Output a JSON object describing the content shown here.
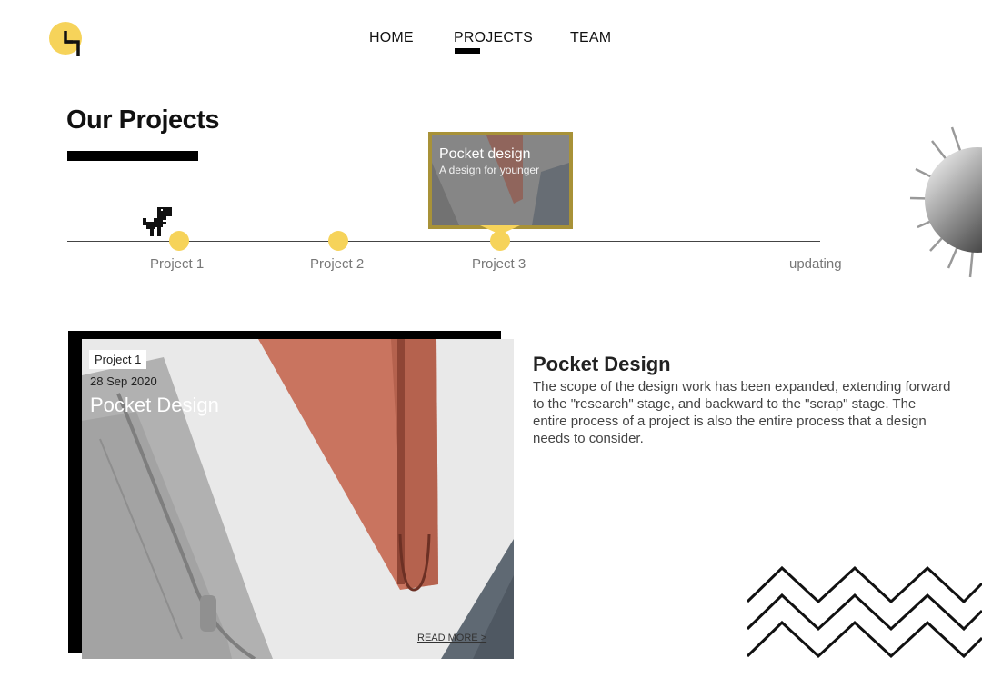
{
  "nav": {
    "items": [
      {
        "label": "HOME"
      },
      {
        "label": "PROJECTS",
        "active": true
      },
      {
        "label": "TEAM"
      }
    ]
  },
  "page": {
    "title": "Our Projects"
  },
  "timeline": {
    "items": [
      {
        "label": "Project 1"
      },
      {
        "label": "Project 2"
      },
      {
        "label": "Project 3"
      },
      {
        "label": "updating"
      }
    ],
    "tooltip": {
      "title": "Pocket design",
      "subtitle": "A design for younger"
    }
  },
  "card": {
    "tag": "Project 1",
    "date": "28 Sep 2020",
    "title": "Pocket Design",
    "read_more": "READ MORE >"
  },
  "description": {
    "title": "Pocket Design",
    "body": "The scope of the design work has been expanded, extending forward to the \"research\" stage, and backward to the \"scrap\" stage. The entire process of a project is also the entire process that a design needs to consider."
  },
  "icons": {
    "logo": "logo-icon",
    "dino": "dinosaur-icon",
    "sun": "sun-decoration",
    "zigzag": "zigzag-decoration"
  },
  "colors": {
    "accent": "#f6d35a",
    "tooltip_border": "#a89238",
    "text": "#111111"
  }
}
